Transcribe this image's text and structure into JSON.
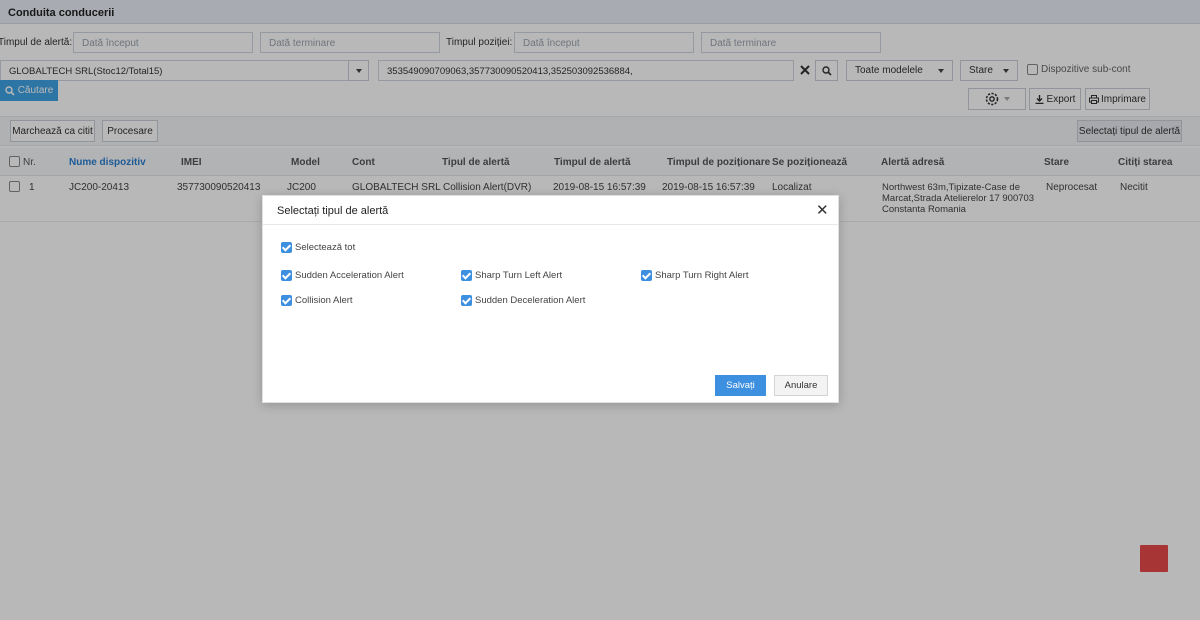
{
  "page": {
    "title": "Conduita conducerii"
  },
  "filters": {
    "alert_time_label": "Timpul de alertă:",
    "alert_start_placeholder": "Dată început",
    "alert_end_placeholder": "Dată terminare",
    "position_time_label": "Timpul poziției:",
    "position_start_placeholder": "Dată început",
    "position_end_placeholder": "Dată terminare",
    "account_value": "GLOBALTECH SRL(Stoc12/Total15)",
    "imei_value": "353549090709063,357730090520413,352503092536884,",
    "model_value": "Toate modelele",
    "status_value": "Stare",
    "subaccount_label": "Dispozitive sub-cont",
    "search_label": "Căutare"
  },
  "actions": {
    "export_label": "Export",
    "print_label": "Imprimare",
    "mark_read_label": "Marchează ca citit",
    "process_label": "Procesare",
    "select_alert_type_label": "Selectați tipul de alertă"
  },
  "table": {
    "headers": {
      "nr": "Nr.",
      "device_name": "Nume dispozitiv",
      "imei": "IMEI",
      "model": "Model",
      "account": "Cont",
      "alert_type": "Tipul de alertă",
      "alert_time": "Timpul de alertă",
      "position_time": "Timpul de poziționare",
      "positioning": "Se poziționează",
      "alert_address": "Alertă adresă",
      "status": "Stare",
      "read_status": "Citiți starea"
    },
    "rows": [
      {
        "nr": "1",
        "device_name": "JC200-20413",
        "imei": "357730090520413",
        "model": "JC200",
        "account": "GLOBALTECH SRL",
        "alert_type": "Collision Alert(DVR)",
        "alert_time": "2019-08-15 16:57:39",
        "position_time": "2019-08-15 16:57:39",
        "positioning": "Localizat",
        "address_line1": "Northwest 63m,Tipizate-Case de",
        "address_line2": "Marcat,Strada Atelierelor 17 900703",
        "address_line3": "Constanta Romania",
        "status": "Neprocesat",
        "read_status": "Necitit"
      }
    ]
  },
  "modal": {
    "title": "Selectați tipul de alertă",
    "select_all_label": "Selectează tot",
    "options": [
      {
        "label": "Sudden Acceleration Alert",
        "checked": true
      },
      {
        "label": "Sharp Turn Left Alert",
        "checked": true
      },
      {
        "label": "Sharp Turn Right Alert",
        "checked": true
      },
      {
        "label": "Collision Alert",
        "checked": true
      },
      {
        "label": "Sudden Deceleration Alert",
        "checked": true
      }
    ],
    "save_label": "Salvați",
    "cancel_label": "Anulare"
  },
  "colors": {
    "accent": "#3d8fe0",
    "search_button": "#3da2e3",
    "link_header": "#2a7fd0",
    "floating_button": "#e84a4a"
  },
  "icons": {
    "search": "search-icon",
    "clear": "clear-icon",
    "settings": "gear-icon",
    "export": "download-icon",
    "print": "printer-icon",
    "close": "close-icon"
  }
}
